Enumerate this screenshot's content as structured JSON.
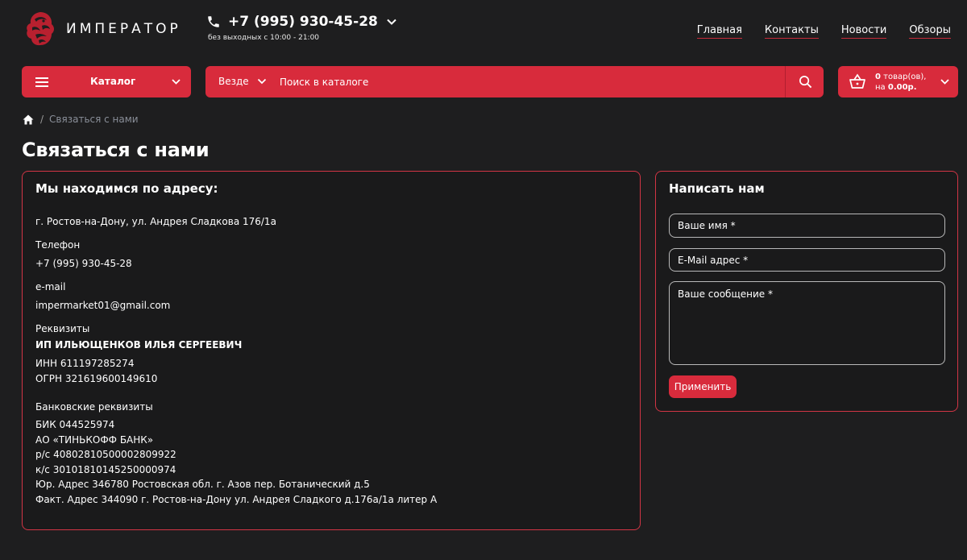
{
  "header": {
    "logo_text": "ИМПЕРАТОР",
    "phone": "+7 (995) 930-45-28",
    "hours": "без выходных с 10:00 - 21:00",
    "nav": [
      "Главная",
      "Контакты",
      "Новости",
      "Обзоры"
    ]
  },
  "toolbar": {
    "catalog_label": "Каталог",
    "scope_label": "Везде",
    "search_placeholder": "Поиск в каталоге",
    "cart_count": "0",
    "cart_count_suffix": " товар(ов),",
    "cart_total_prefix": "на ",
    "cart_total": "0.00р."
  },
  "breadcrumb": {
    "separator": "/",
    "current": "Связаться с нами"
  },
  "page_title": "Связаться с нами",
  "contacts": {
    "heading": "Мы находимся по адресу:",
    "address": "г. Ростов-на-Дону, ул. Андрея Сладкова 176/1а",
    "phone_label": "Телефон",
    "phone": "+7 (995) 930-45-28",
    "email_label": "e-mail",
    "email": "impermarket01@gmail.com",
    "requisites_label": "Реквизиты",
    "company": "ИП ИЛЬЮЩЕНКОВ ИЛЬЯ СЕРГЕЕВИЧ",
    "inn": "ИНН 611197285274",
    "ogrn": "ОГРН 321619600149610",
    "bank_label": "Банковские реквизиты",
    "bank_lines": [
      "БИК 044525974",
      "АО «ТИНЬКОФФ БАНК»",
      "р/с 40802810500002809922",
      "к/с 30101810145250000974",
      "Юр. Адрес 346780 Ростовская обл. г. Азов пер. Ботанический д.5",
      "Факт. Адрес 344090 г. Ростов-на-Дону ул. Андрея Сладкого д.176а/1а литер А"
    ]
  },
  "form": {
    "heading": "Написать нам",
    "name_placeholder": "Ваше имя *",
    "email_placeholder": "E-Mail адрес *",
    "message_placeholder": "Ваше сообщение *",
    "submit_label": "Применить"
  },
  "colors": {
    "accent": "#d82b3c",
    "background": "#1e1e1f",
    "card_border": "#d23545"
  }
}
